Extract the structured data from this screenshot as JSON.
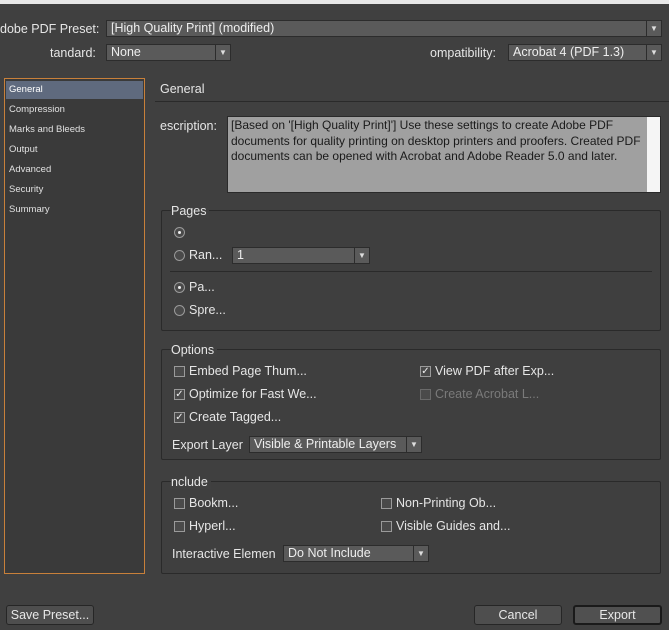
{
  "header": {
    "preset_label": "dobe PDF Preset:",
    "preset_value": "[High Quality Print] (modified)",
    "standard_label": "tandard:",
    "standard_value": "None",
    "compat_label": "ompatibility:",
    "compat_value": "Acrobat 4 (PDF 1.3)",
    "dropdown_icon": "chevron-down-icon"
  },
  "sidebar": {
    "items": [
      {
        "label": "General",
        "selected": true
      },
      {
        "label": "Compression",
        "selected": false
      },
      {
        "label": "Marks and Bleeds",
        "selected": false
      },
      {
        "label": "Output",
        "selected": false
      },
      {
        "label": "Advanced",
        "selected": false
      },
      {
        "label": "Security",
        "selected": false
      },
      {
        "label": "Summary",
        "selected": false
      }
    ]
  },
  "main": {
    "section_title": "General",
    "description_label": "escription:",
    "description_text": "[Based on '[High Quality Print]'] Use these settings to create Adobe PDF documents for quality printing on desktop printers and proofers. Created PDF documents can be opened with Acrobat and Adobe Reader 5.0 and later.",
    "pages": {
      "title": "Pages",
      "range_label": "Ran...",
      "range_value": "1",
      "pages_label": "Pa...",
      "spreads_label": "Spre..."
    },
    "options": {
      "title": "Options",
      "embed_thumbnails": "Embed Page Thum...",
      "optimize_fast_web": "Optimize for Fast We...",
      "create_tagged": "Create Tagged...",
      "view_after_export": "View PDF after Exp...",
      "create_acrobat_layers": "Create Acrobat L...",
      "export_layers_label": "Export Layer",
      "export_layers_value": "Visible & Printable Layers"
    },
    "include": {
      "title": "nclude",
      "bookmarks": "Bookm...",
      "hyperlinks": "Hyperl...",
      "non_printing": "Non-Printing Ob...",
      "visible_guides": "Visible Guides and...",
      "interactive_label": "Interactive Elemen",
      "interactive_value": "Do Not Include"
    }
  },
  "footer": {
    "save_preset": "Save Preset...",
    "cancel": "Cancel",
    "export": "Export"
  },
  "colors": {
    "background": "#404040",
    "selected_item": "#5f6a7e",
    "sidebar_border": "#c8803a"
  }
}
